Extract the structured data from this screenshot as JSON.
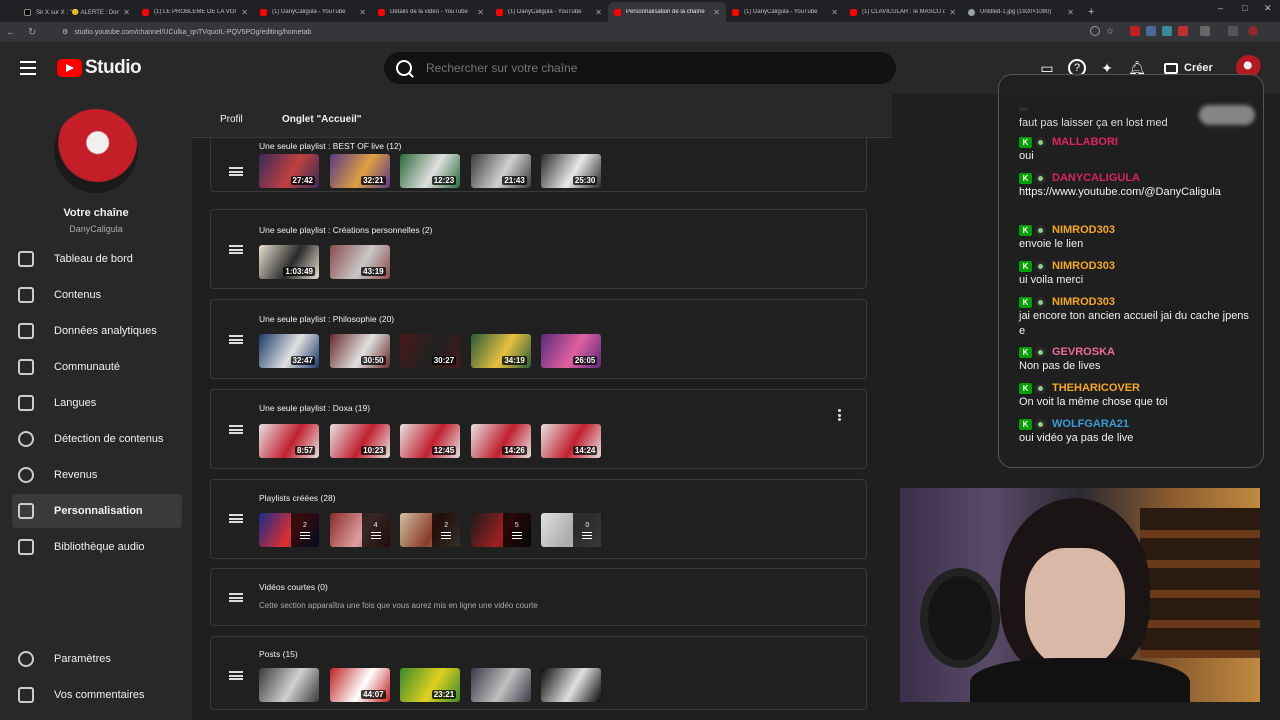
{
  "browser": {
    "tabs": [
      {
        "title": "Sir X sur X : \"😊 ALERTE : Don",
        "icon": "x-icon"
      },
      {
        "title": "(1) LE PROBLÈME DE LA VOITU",
        "icon": "youtube-icon"
      },
      {
        "title": "(1) DanyCaligula - YouTube",
        "icon": "youtube-icon"
      },
      {
        "title": "Détails de la vidéo - YouTube",
        "icon": "youtube-icon"
      },
      {
        "title": "(1) DanyCaligula - YouTube",
        "icon": "youtube-icon"
      },
      {
        "title": "Personnalisation de la chaîne",
        "icon": "youtube-icon",
        "active": true
      },
      {
        "title": "(1) DanyCaligula - YouTube",
        "icon": "youtube-icon"
      },
      {
        "title": "(1) CLAVICULAR : le MASCU qu",
        "icon": "youtube-icon"
      },
      {
        "title": "Untitled-1.jpg (1920×1080)",
        "icon": "globe-icon"
      }
    ],
    "url": "studio.youtube.com/channel/UCulka_qnTVquoIL-PQV5POg/editing/hometab"
  },
  "header": {
    "logo_text": "Studio",
    "search_placeholder": "Rechercher sur votre chaîne",
    "create_label": "Créer"
  },
  "sidebar": {
    "channel_title": "Votre chaîne",
    "channel_handle": "DanyCaligula",
    "items": [
      {
        "label": "Tableau de bord",
        "icon": "dashboard-icon"
      },
      {
        "label": "Contenus",
        "icon": "content-icon"
      },
      {
        "label": "Données analytiques",
        "icon": "analytics-icon"
      },
      {
        "label": "Communauté",
        "icon": "community-icon"
      },
      {
        "label": "Langues",
        "icon": "subtitles-icon"
      },
      {
        "label": "Détection de contenus",
        "icon": "copyright-icon"
      },
      {
        "label": "Revenus",
        "icon": "dollar-icon"
      },
      {
        "label": "Personnalisation",
        "icon": "magic-wand-icon",
        "active": true
      },
      {
        "label": "Bibliothèque audio",
        "icon": "audio-library-icon"
      }
    ],
    "bottom_items": [
      {
        "label": "Paramètres",
        "icon": "gear-icon"
      },
      {
        "label": "Vos commentaires",
        "icon": "feedback-icon"
      }
    ]
  },
  "page_tabs": [
    {
      "label": "Profil"
    },
    {
      "label": "Onglet \"Accueil\"",
      "active": true
    }
  ],
  "sections": [
    {
      "title": "Une seule playlist : BEST OF live (12)",
      "thumbs": [
        {
          "label": "27:42",
          "colors": [
            "#3a2a5a",
            "#c04040"
          ]
        },
        {
          "label": "32:21",
          "colors": [
            "#5a3a8a",
            "#e0a040"
          ]
        },
        {
          "label": "12:23",
          "colors": [
            "#2a6a3a",
            "#e0e0e0"
          ]
        },
        {
          "label": "21:43",
          "colors": [
            "#3a3a3a",
            "#d0d0d0"
          ]
        },
        {
          "label": "25:30",
          "colors": [
            "#2a2a2a",
            "#e8e8e8"
          ]
        }
      ]
    },
    {
      "title": "Une seule playlist : Créations personnelles (2)",
      "thumbs": [
        {
          "label": "1:03:49",
          "colors": [
            "#e8e0d0",
            "#2a2a2a"
          ]
        },
        {
          "label": "43:19",
          "colors": [
            "#8a4a4a",
            "#c8c8c8"
          ]
        }
      ]
    },
    {
      "title": "Une seule playlist : Philosophie (20)",
      "thumbs": [
        {
          "label": "32:47",
          "colors": [
            "#1a3a6a",
            "#e0e0e0"
          ]
        },
        {
          "label": "30:50",
          "colors": [
            "#6a2a2a",
            "#e0e0e0"
          ]
        },
        {
          "label": "30:27",
          "colors": [
            "#4a1a1a",
            "#202020"
          ]
        },
        {
          "label": "34:19",
          "colors": [
            "#2a5a3a",
            "#e8c040"
          ]
        },
        {
          "label": "26:05",
          "colors": [
            "#5a2a7a",
            "#e060a0"
          ]
        }
      ]
    },
    {
      "title": "Une seule playlist : Doxa (19)",
      "thumbs": [
        {
          "label": "8:57",
          "colors": [
            "#e8e0e0",
            "#c02030"
          ]
        },
        {
          "label": "10:23",
          "colors": [
            "#e8e0e0",
            "#c02030"
          ]
        },
        {
          "label": "12:45",
          "colors": [
            "#e8e0e0",
            "#c02030"
          ]
        },
        {
          "label": "14:26",
          "colors": [
            "#e8e0e0",
            "#c02030"
          ]
        },
        {
          "label": "14:24",
          "colors": [
            "#e8e0e0",
            "#c02030"
          ]
        }
      ]
    },
    {
      "title": "Playlists créées (28)",
      "playlist_thumbs": [
        {
          "count": "2",
          "colors": [
            "#1a2a8a",
            "#e03030"
          ]
        },
        {
          "count": "4",
          "colors": [
            "#8a2a2a",
            "#e0a0a0"
          ]
        },
        {
          "count": "2",
          "colors": [
            "#d0c0a0",
            "#8a3a2a"
          ]
        },
        {
          "count": "5",
          "colors": [
            "#1a1a1a",
            "#a02020"
          ]
        },
        {
          "count": "0",
          "colors": [
            "#e0e0e0",
            "#aaaaaa"
          ]
        }
      ]
    },
    {
      "title": "Vidéos courtes (0)",
      "subtitle": "Cette section apparaîtra une fois que vous aurez mis en ligne une vidéo courte"
    },
    {
      "title": "Posts (15)",
      "thumbs": [
        {
          "label": "",
          "colors": [
            "#3a3a3a",
            "#d0d0d0"
          ]
        },
        {
          "label": "44:07",
          "colors": [
            "#c02020",
            "#ffffff"
          ]
        },
        {
          "label": "23:21",
          "colors": [
            "#3a8a2a",
            "#e0d020"
          ]
        },
        {
          "label": "",
          "colors": [
            "#3a3a4a",
            "#c0c0c0"
          ]
        },
        {
          "label": "",
          "colors": [
            "#0a0a0a",
            "#e0e0e0"
          ]
        }
      ]
    }
  ],
  "chat": {
    "top_text_1": "...",
    "top_text_2": "faut pas laisser ça en lost med",
    "messages": [
      {
        "user": "MALLABORI",
        "color": "#e0245e",
        "text": "oui"
      },
      {
        "user": "DANYCALIGULA",
        "color": "#d8255a",
        "text": "https://www.youtube.com/@DanyCaligula"
      },
      {
        "user": "NIMROD303",
        "color": "#f4a81d",
        "text": "envoie le lien"
      },
      {
        "user": "NIMROD303",
        "color": "#f4a81d",
        "text": "ui voila merci"
      },
      {
        "user": "NIMROD303",
        "color": "#f4a81d",
        "text": "jai encore ton ancien accueil jai du cache jpense"
      },
      {
        "user": "GEVROSKA",
        "color": "#ef6a9a",
        "text": "Non pas de lives"
      },
      {
        "user": "THEHARICOVER",
        "color": "#f4a81d",
        "text": "On voit la même chose que toi"
      },
      {
        "user": "WOLFGARA21",
        "color": "#3d9bdb",
        "text": "oui vidéo ya pas de live"
      }
    ]
  }
}
